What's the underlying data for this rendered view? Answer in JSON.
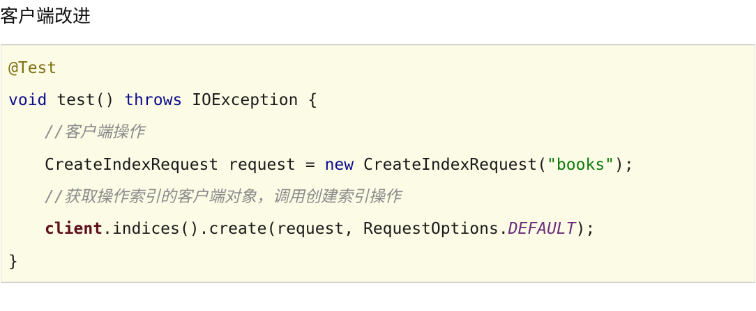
{
  "page": {
    "title": "客户端改进"
  },
  "code": {
    "annotation": "@Test",
    "line2": {
      "void": "void",
      "method": "test()",
      "throws": "throws",
      "exception": "IOException {"
    },
    "comment1": "//客户端操作",
    "line4": {
      "decl": "CreateIndexRequest request = ",
      "new": "new",
      "ctor": " CreateIndexRequest(",
      "string": "\"books\"",
      "end": ");"
    },
    "comment2": "//获取操作索引的客户端对象，调用创建索引操作",
    "line6": {
      "client": "client",
      "call": ".indices().create(request, RequestOptions.",
      "const": "DEFAULT",
      "end": ");"
    },
    "close": "}"
  }
}
